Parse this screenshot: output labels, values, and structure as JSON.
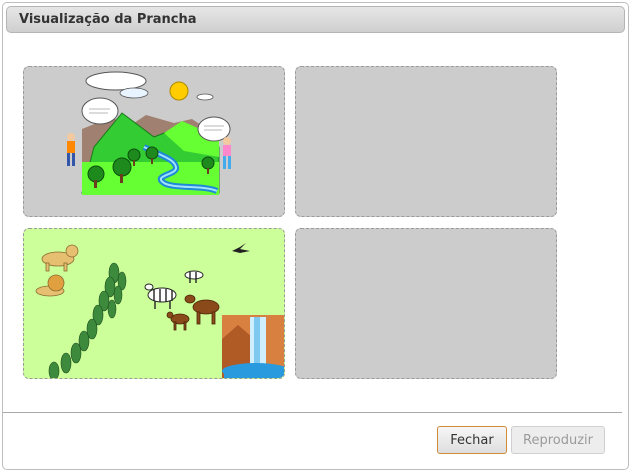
{
  "dialog": {
    "title": "Visualização da Prancha",
    "buttons": {
      "close": "Fechar",
      "play": "Reproduzir"
    }
  },
  "board": {
    "cells": [
      {
        "content": "mountain-landscape-image",
        "empty": false
      },
      {
        "content": "",
        "empty": true
      },
      {
        "content": "savanna-animals-image",
        "empty": false
      },
      {
        "content": "",
        "empty": true
      }
    ]
  },
  "colors": {
    "cell_empty": "#cccccc",
    "cell_highlight": "#ccff99",
    "focus_border": "#d08b3a"
  }
}
